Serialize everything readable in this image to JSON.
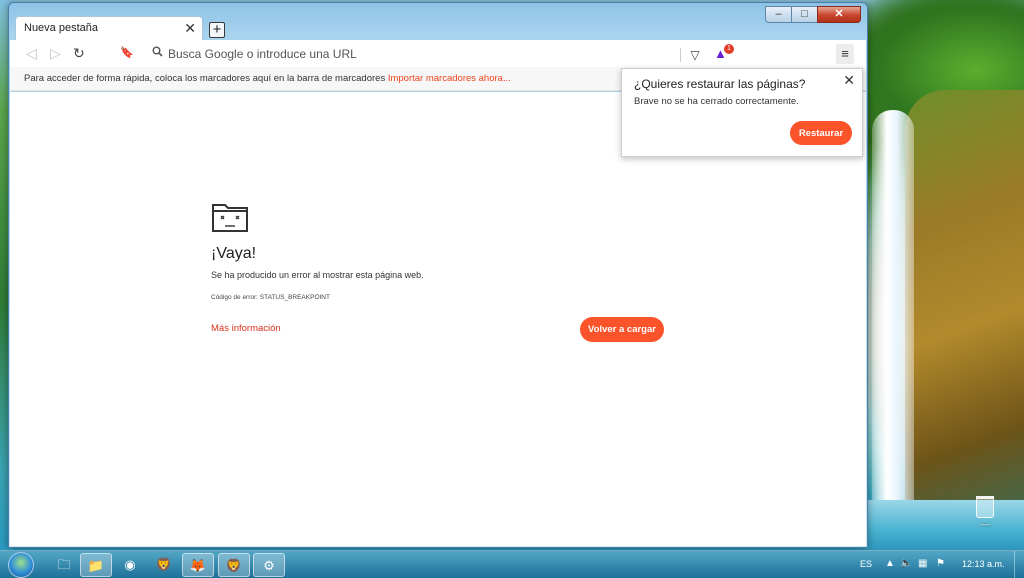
{
  "desktop": {
    "recycle_bin_label": "----"
  },
  "browser": {
    "tab_title": "Nueva pestaña",
    "tab_close": "✕",
    "new_tab": "+",
    "window_controls": {
      "minimize": "–",
      "maximize": "□",
      "close": "✕"
    },
    "nav": {
      "back_icon": "◁",
      "forward_icon": "▷",
      "reload_icon": "↻",
      "bookmark_icon": "🔖"
    },
    "omnibox": {
      "placeholder": "Busca Google o introduce una URL",
      "value": ""
    },
    "shields_icon": "▽",
    "rewards_icon": "▲",
    "rewards_badge": "1",
    "menu_icon": "≡",
    "bookmarks_bar": {
      "text": "Para acceder de forma rápida, coloca los marcadores aquí en la barra de marcadores ",
      "import_link": "Importar marcadores ahora..."
    }
  },
  "error_page": {
    "title": "¡Vaya!",
    "description": "Se ha producido un error al mostrar esta página web.",
    "error_code": "Código de error: STATUS_BREAKPOINT",
    "more_info": "Más información",
    "reload_button": "Volver a cargar"
  },
  "restore_popup": {
    "title": "¿Quieres restaurar las páginas?",
    "message": "Brave no se ha cerrado correctamente.",
    "close_icon": "✕",
    "restore_button": "Restaurar"
  },
  "taskbar": {
    "apps": [
      {
        "name": "explorer",
        "glyph": "🗀"
      },
      {
        "name": "folder",
        "glyph": "📁"
      },
      {
        "name": "app-yellow",
        "glyph": "◉"
      },
      {
        "name": "brave-red",
        "glyph": "🦁"
      },
      {
        "name": "firefox",
        "glyph": "🦊"
      },
      {
        "name": "brave-active",
        "glyph": "🦁"
      },
      {
        "name": "tool",
        "glyph": "⚙"
      }
    ],
    "language": "ES",
    "clock": "12:13 a.m.",
    "tray_icons": {
      "arrow": "▲",
      "volume": "🔈",
      "network": "▦",
      "flag": "⚑"
    }
  },
  "colors": {
    "accent": "#fb542b",
    "link_red": "#d9321e"
  }
}
